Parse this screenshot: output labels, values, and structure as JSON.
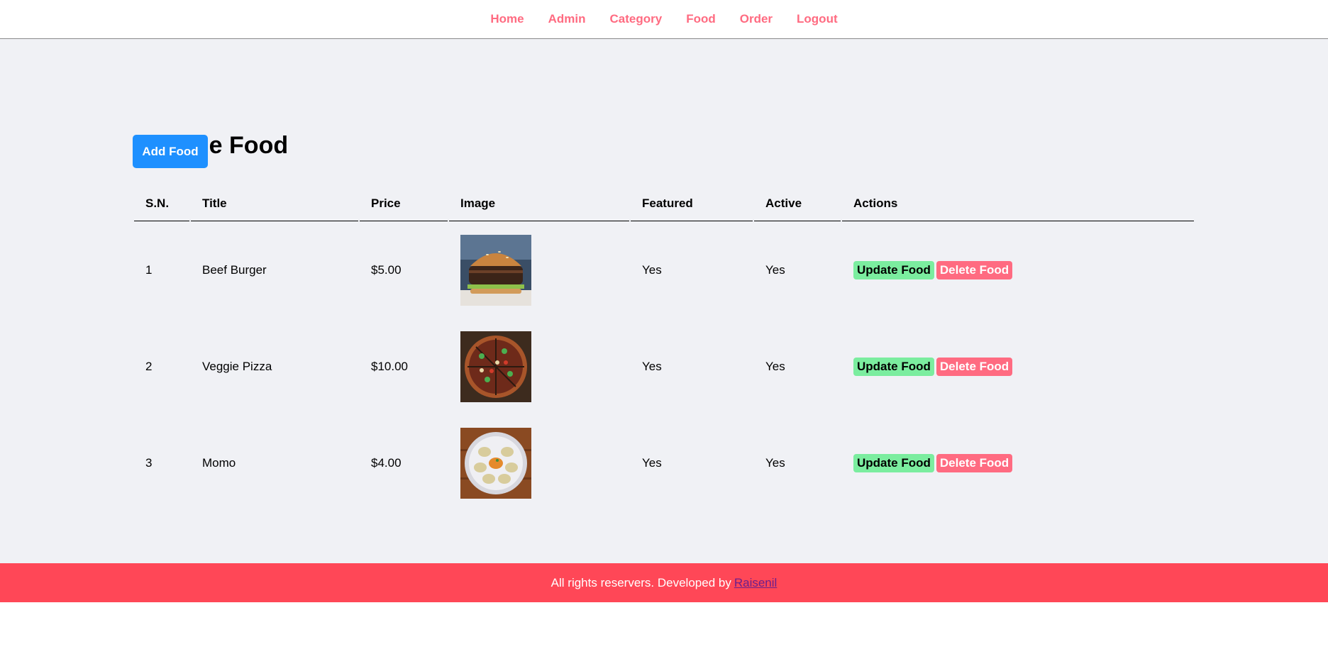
{
  "nav": {
    "items": [
      {
        "label": "Home"
      },
      {
        "label": "Admin"
      },
      {
        "label": "Category"
      },
      {
        "label": "Food"
      },
      {
        "label": "Order"
      },
      {
        "label": "Logout"
      }
    ]
  },
  "page": {
    "title": "Manage Food",
    "add_button": "Add Food"
  },
  "table": {
    "headers": [
      "S.N.",
      "Title",
      "Price",
      "Image",
      "Featured",
      "Active",
      "Actions"
    ],
    "rows": [
      {
        "sn": "1",
        "title": "Beef Burger",
        "price": "$5.00",
        "image_icon": "burger-image",
        "featured": "Yes",
        "active": "Yes",
        "update_label": "Update Food",
        "delete_label": "Delete Food"
      },
      {
        "sn": "2",
        "title": "Veggie Pizza",
        "price": "$10.00",
        "image_icon": "pizza-image",
        "featured": "Yes",
        "active": "Yes",
        "update_label": "Update Food",
        "delete_label": "Delete Food"
      },
      {
        "sn": "3",
        "title": "Momo",
        "price": "$4.00",
        "image_icon": "momo-image",
        "featured": "Yes",
        "active": "Yes",
        "update_label": "Update Food",
        "delete_label": "Delete Food"
      }
    ]
  },
  "footer": {
    "text": "All rights reservers. Developed by",
    "link": "Raisenil"
  },
  "colors": {
    "nav_link": "#ff6b81",
    "primary_button": "#1e90ff",
    "update_button": "#7bed9f",
    "delete_button": "#ff6b81",
    "footer_bg": "#ff4757",
    "main_bg": "#f0f1f5"
  }
}
